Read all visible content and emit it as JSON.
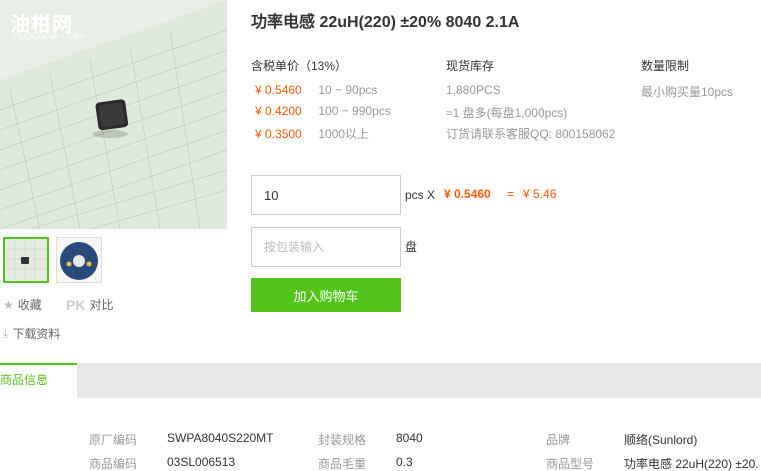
{
  "gallery": {
    "watermark_text": "油柑网",
    "watermark_sub": "YOUGANNET.COM"
  },
  "actions": {
    "collect_label": "收藏",
    "pk_label": "PK",
    "compare_label": "对比",
    "download_label": "下载资料"
  },
  "product": {
    "title": "功率电感 22uH(220) ±20% 8040 2.1A"
  },
  "pricing": {
    "header": "含税单价（13%）",
    "tiers": [
      {
        "price": "¥ 0.5460",
        "range": "10 ~ 90pcs"
      },
      {
        "price": "¥ 0.4200",
        "range": "100 ~ 990pcs"
      },
      {
        "price": "¥ 0.3500",
        "range": "1000以上"
      }
    ]
  },
  "stock": {
    "header": "现货库存",
    "quantity": "1,880PCS",
    "reels": "≈1 盘多(每盘1,000pcs)",
    "contact": "订货请联系客服QQ: 800158062"
  },
  "limit": {
    "header": "数量限制",
    "value": "最小购买量10pcs"
  },
  "order": {
    "qty_value": "10",
    "unit_label": "pcs X",
    "unit_price": "¥ 0.5460",
    "equals": "=",
    "total": "¥ 5.46",
    "reel_placeholder": "按包装输入",
    "reel_unit": "盘",
    "cart_button": "加入购物车"
  },
  "tabs": {
    "active": "商品信息"
  },
  "info": {
    "rows": [
      [
        {
          "label": "原厂编码",
          "value": "SWPA8040S220MT"
        },
        {
          "label": "封装规格",
          "value": "8040"
        },
        {
          "label": "品牌",
          "value": "顺络(Sunlord)"
        }
      ],
      [
        {
          "label": "商品编码",
          "value": "03SL006513"
        },
        {
          "label": "商品毛重",
          "value": "0.3"
        },
        {
          "label": "商品型号",
          "value": "功率电感 22uH(220) ±20."
        }
      ]
    ]
  },
  "colors": {
    "accent_green": "#52c41a",
    "price_orange": "#ff5a00"
  }
}
